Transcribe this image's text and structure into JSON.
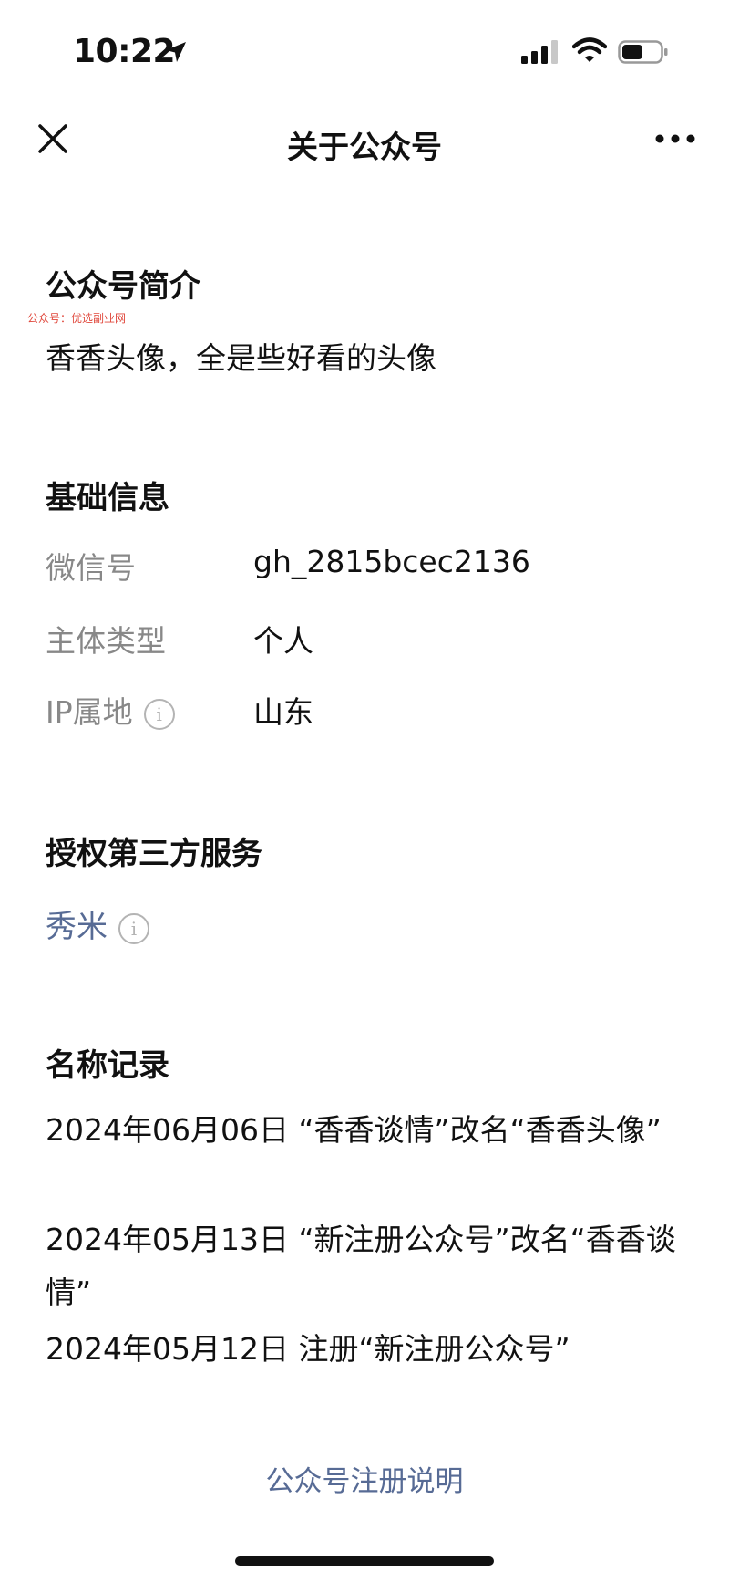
{
  "status_bar": {
    "time": "10:22"
  },
  "nav": {
    "title": "关于公众号"
  },
  "watermark": "公众号：优选副业网",
  "intro": {
    "title": "公众号简介",
    "text": "香香头像，全是些好看的头像"
  },
  "basic_info": {
    "title": "基础信息",
    "rows": [
      {
        "label": "微信号",
        "value": "gh_2815bcec2136"
      },
      {
        "label": "主体类型",
        "value": "个人"
      },
      {
        "label": "IP属地",
        "value": "山东"
      }
    ],
    "info_glyph": "i"
  },
  "third_party": {
    "title": "授权第三方服务",
    "service": "秀米"
  },
  "name_history": {
    "title": "名称记录",
    "records": [
      "2024年06月06日 “香香谈情”改名“香香头像”",
      "2024年05月13日 “新注册公众号”改名“香香谈情”",
      "2024年05月12日 注册“新注册公众号”"
    ]
  },
  "footer": {
    "link": "公众号注册说明"
  }
}
